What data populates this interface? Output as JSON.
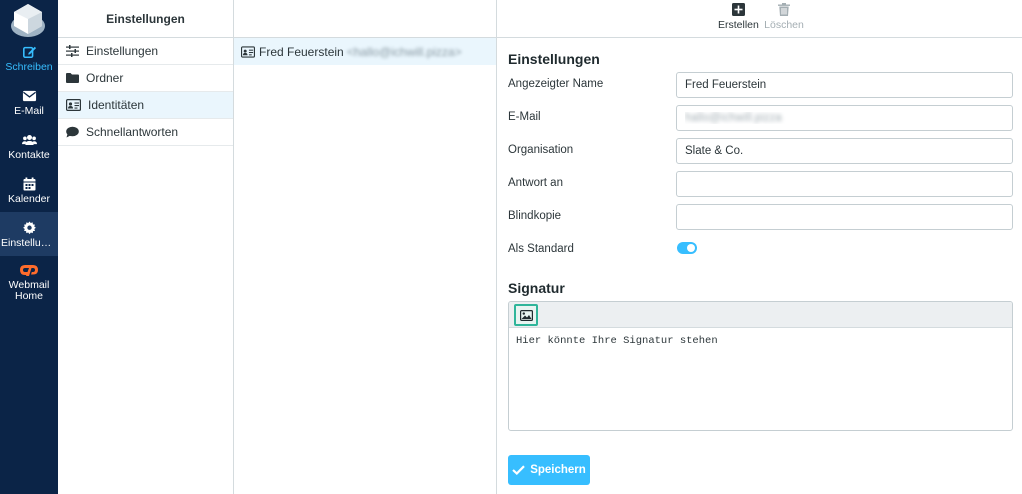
{
  "nav": {
    "items": [
      {
        "label": "Schreiben",
        "icon": "compose-icon"
      },
      {
        "label": "E-Mail",
        "icon": "envelope-icon"
      },
      {
        "label": "Kontakte",
        "icon": "users-icon"
      },
      {
        "label": "Kalender",
        "icon": "calendar-icon"
      },
      {
        "label": "Einstellungen",
        "icon": "gear-icon"
      },
      {
        "label": "Webmail Home",
        "icon": "cpanel-icon"
      }
    ]
  },
  "settings_menu": {
    "title": "Einstellungen",
    "items": [
      {
        "label": "Einstellungen",
        "icon": "sliders-icon"
      },
      {
        "label": "Ordner",
        "icon": "folder-icon"
      },
      {
        "label": "Identitäten",
        "icon": "id-card-icon"
      },
      {
        "label": "Schnellantworten",
        "icon": "speech-bubble-icon"
      }
    ]
  },
  "identities": {
    "items": [
      {
        "name": "Fred Feuerstein",
        "email": "<hallo@ichwill.pizza>"
      }
    ]
  },
  "toolbar": {
    "create_label": "Erstellen",
    "delete_label": "Löschen"
  },
  "identity_form": {
    "title": "Einstellungen",
    "fields": [
      {
        "label": "Angezeigter Name",
        "value": "Fred Feuerstein"
      },
      {
        "label": "E-Mail",
        "value": "hallo@ichwill.pizza"
      },
      {
        "label": "Organisation",
        "value": "Slate & Co."
      },
      {
        "label": "Antwort an",
        "value": ""
      },
      {
        "label": "Blindkopie",
        "value": ""
      }
    ],
    "default_label": "Als Standard",
    "default_on": true
  },
  "signature": {
    "title": "Signatur",
    "text": "Hier könnte Ihre Signatur stehen"
  },
  "save_label": "Speichern",
  "colors": {
    "nav_bg": "#0b2447",
    "accent": "#37beff",
    "selected_row": "#eaf6fd",
    "cpanel_orange": "#ff6c2c"
  }
}
